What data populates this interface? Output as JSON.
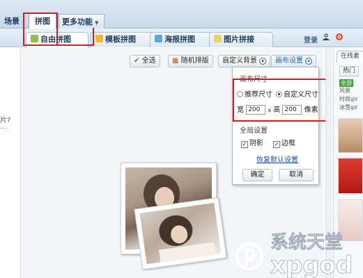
{
  "menu": {
    "scene": "场景",
    "puzzle": "拼图",
    "more": "更多功能"
  },
  "tabs": [
    {
      "label": "自由拼图",
      "active": true,
      "icon": "free-puzzle-icon"
    },
    {
      "label": "模板拼图",
      "active": false,
      "icon": "template-icon"
    },
    {
      "label": "海报拼图",
      "active": false,
      "icon": "poster-icon"
    },
    {
      "label": "图片拼接",
      "active": false,
      "icon": "splice-icon"
    }
  ],
  "header": {
    "login": "登录"
  },
  "toolbar": {
    "select_all": "全选",
    "random_layout": "随机排版",
    "custom_background": "自定义背景",
    "canvas_settings": "画布设置"
  },
  "settings": {
    "canvas_size_title": "画布尺寸",
    "recommended_size": "推荐尺寸",
    "custom_size": "自定义尺寸",
    "custom_selected": true,
    "width_label": "宽",
    "width_value": "200",
    "times": "x",
    "height_label": "高",
    "height_value": "200",
    "unit": "像素",
    "global_title": "全局设置",
    "shadow_label": "阴影",
    "shadow_checked": true,
    "border_label": "边框",
    "border_checked": true,
    "default_link": "恢复默认设置",
    "ok": "确定",
    "cancel": "取消"
  },
  "right_panel": {
    "tab": "在线素",
    "hot": "热门",
    "all": "全部",
    "items": [
      "风景",
      "时尚gir",
      "冰雪gir"
    ]
  },
  "left_panel": {
    "q": "片?",
    "dots": "…"
  },
  "watermark": {
    "text": "系统天堂",
    "sub": "xpgod"
  },
  "colors": {
    "highlight": "#e3141b",
    "accent": "#2860a8"
  }
}
